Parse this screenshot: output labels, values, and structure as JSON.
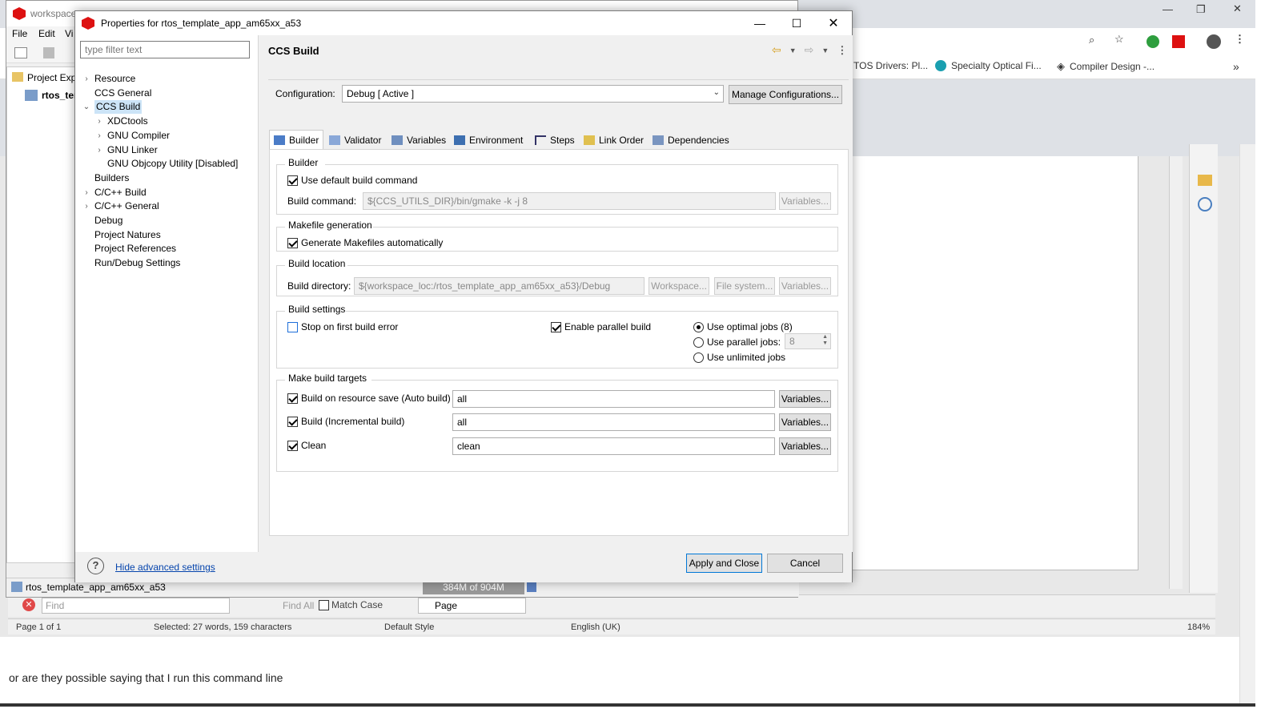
{
  "browser": {
    "bookmarks": [
      "TOS Drivers: Pl...",
      "Specialty Optical Fi...",
      "Compiler Design -..."
    ],
    "more": "»"
  },
  "workbench": {
    "title": "workspace",
    "menu": [
      "File",
      "Edit",
      "Vi"
    ],
    "project_explorer": "Project Exp",
    "project_item": "rtos_ter",
    "status_project": "rtos_template_app_am65xx_a53",
    "heap": "384M of 904M"
  },
  "writer": {
    "find_placeholder": "Find",
    "find_all": "Find All",
    "match_case": "Match Case",
    "page_select": "Page",
    "status": {
      "page": "Page 1 of 1",
      "selected": "Selected: 27 words, 159 characters",
      "style": "Default Style",
      "language": "English (UK)",
      "zoom": "184%"
    }
  },
  "below_text": "or are they possible saying that I run this command line",
  "dialog": {
    "title": "Properties for rtos_template_app_am65xx_a53",
    "filter_placeholder": "type filter text",
    "tree": [
      {
        "label": "Resource",
        "indent": 0,
        "twisty": "›"
      },
      {
        "label": "CCS General",
        "indent": 0,
        "twisty": ""
      },
      {
        "label": "CCS Build",
        "indent": 0,
        "twisty": "⌄",
        "selected": true
      },
      {
        "label": "XDCtools",
        "indent": 1,
        "twisty": "›"
      },
      {
        "label": "GNU Compiler",
        "indent": 1,
        "twisty": "›"
      },
      {
        "label": "GNU Linker",
        "indent": 1,
        "twisty": "›"
      },
      {
        "label": "GNU Objcopy Utility  [Disabled]",
        "indent": 1,
        "twisty": ""
      },
      {
        "label": "Builders",
        "indent": 0,
        "twisty": ""
      },
      {
        "label": "C/C++ Build",
        "indent": 0,
        "twisty": "›"
      },
      {
        "label": "C/C++ General",
        "indent": 0,
        "twisty": "›"
      },
      {
        "label": "Debug",
        "indent": 0,
        "twisty": ""
      },
      {
        "label": "Project Natures",
        "indent": 0,
        "twisty": ""
      },
      {
        "label": "Project References",
        "indent": 0,
        "twisty": ""
      },
      {
        "label": "Run/Debug Settings",
        "indent": 0,
        "twisty": ""
      }
    ],
    "page_title": "CCS Build",
    "configuration_label": "Configuration:",
    "configuration_value": "Debug  [ Active ]",
    "manage_button": "Manage Configurations...",
    "tabs": [
      "Builder",
      "Validator",
      "Variables",
      "Environment",
      "Steps",
      "Link Order",
      "Dependencies"
    ],
    "builder": {
      "title": "Builder",
      "use_default": "Use default build command",
      "build_command_label": "Build command:",
      "build_command_value": "${CCS_UTILS_DIR}/bin/gmake -k -j 8",
      "variables": "Variables..."
    },
    "makefile": {
      "title": "Makefile generation",
      "generate": "Generate Makefiles automatically"
    },
    "location": {
      "title": "Build location",
      "dir_label": "Build directory:",
      "dir_value": "${workspace_loc:/rtos_template_app_am65xx_a53}/Debug",
      "workspace": "Workspace...",
      "filesystem": "File system...",
      "variables": "Variables..."
    },
    "settings": {
      "title": "Build settings",
      "stop_first": "Stop on first build error",
      "parallel": "Enable parallel build",
      "optimal": "Use optimal jobs (8)",
      "parallel_jobs": "Use parallel jobs:",
      "parallel_jobs_value": "8",
      "unlimited": "Use unlimited jobs"
    },
    "targets": {
      "title": "Make build targets",
      "auto": "Build on resource save (Auto build)",
      "auto_value": "all",
      "incremental": "Build (Incremental build)",
      "incremental_value": "all",
      "clean": "Clean",
      "clean_value": "clean",
      "variables": "Variables..."
    },
    "footer": {
      "hide_advanced": "Hide advanced settings",
      "apply_close": "Apply and Close",
      "cancel": "Cancel"
    }
  }
}
